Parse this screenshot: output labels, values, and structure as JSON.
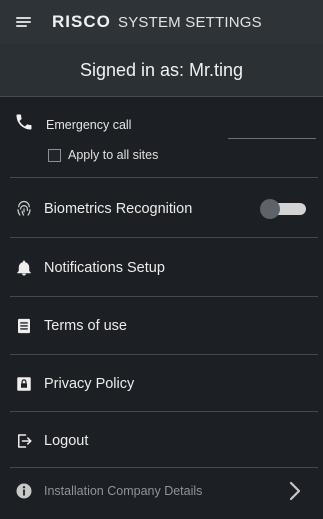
{
  "header": {
    "logo": "RISCO",
    "title": "SYSTEM SETTINGS"
  },
  "user": {
    "signed_in_text": "Signed in as: Mr.ting"
  },
  "emergency": {
    "label": "Emergency call",
    "number_value": "",
    "apply_all_label": "Apply to all sites",
    "apply_all_checked": false
  },
  "menu": {
    "biometrics": {
      "label": "Biometrics Recognition",
      "enabled": false,
      "icon": "fingerprint-icon"
    },
    "notifications": {
      "label": "Notifications Setup",
      "icon": "bell-icon"
    },
    "terms": {
      "label": "Terms of use",
      "icon": "document-icon"
    },
    "privacy": {
      "label": "Privacy Policy",
      "icon": "lock-icon"
    },
    "logout": {
      "label": "Logout",
      "icon": "logout-icon"
    },
    "company": {
      "label": "Installation Company Details",
      "icon": "info-icon"
    }
  },
  "colors": {
    "background": "#1c1f23",
    "header": "#2e3338",
    "text": "#ececec",
    "muted": "#8f9499"
  }
}
